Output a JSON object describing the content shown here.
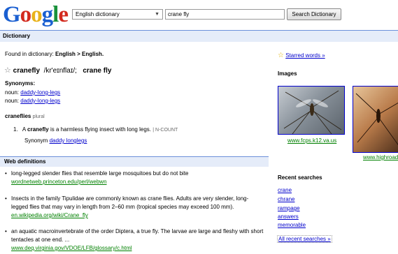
{
  "header": {
    "logo": {
      "G": "G",
      "o1": "o",
      "o2": "o",
      "g": "g",
      "l": "l",
      "e": "e"
    },
    "dictionary_select": "English dictionary",
    "search_value": "crane fly",
    "search_button": "Search Dictionary"
  },
  "section_bar": {
    "title": "Dictionary"
  },
  "entry": {
    "found_prefix": "Found in dictionary: ",
    "found_value": "English > English.",
    "word": "cranefly",
    "pronunciation": "/kr'eɪnflaɪ/;",
    "variant": "crane fly",
    "synonyms_title": "Synonyms:",
    "synonyms": [
      {
        "pos": "noun: ",
        "word": "daddy-long-legs"
      },
      {
        "pos": "noun: ",
        "word": "daddy-long-legs"
      }
    ],
    "plural_word": "craneflies",
    "plural_label": "plural",
    "definition_number": "1.",
    "definition_a": "A ",
    "definition_bold": "cranefly",
    "definition_rest": " is a harmless flying insect with long legs.",
    "definition_tag": "N-COUNT",
    "synonym_label": "Synonym ",
    "synonym_link": "daddy longlegs"
  },
  "web_definitions": {
    "title": "Web definitions",
    "items": [
      {
        "text": "long-legged slender flies that resemble large mosquitoes but do not bite",
        "source": "wordnetweb.princeton.edu/perl/webwn"
      },
      {
        "text": "Insects in the family Tipulidae are commonly known as crane flies. Adults are very slender, long-legged flies that may vary in length from 2–60 mm (tropical species may exceed 100 mm).",
        "source": "en.wikipedia.org/wiki/Crane_fly"
      },
      {
        "text": "an aquatic macroinvertebrate of the order Diptera, a true fly. The larvae are large and fleshy with short tentacles at one end. ...",
        "source": "www.deq.virginia.gov/VDOE/LFB/glossary/c.html"
      }
    ]
  },
  "sidebar": {
    "starred_words": "Starred words »",
    "images_title": "Images",
    "images": [
      {
        "caption": "www.fcps.k12.va.us"
      },
      {
        "caption": "www.highroad"
      }
    ],
    "recent_title": "Recent searches",
    "recent": [
      "crane",
      "chrane",
      "rampage",
      "answers",
      "memorable"
    ],
    "all_recent": "All recent searches »"
  },
  "colors": {
    "link": "#0000cc",
    "url_green": "#008000",
    "bar_bg": "#e5ecf9",
    "bar_border": "#6b90da"
  }
}
